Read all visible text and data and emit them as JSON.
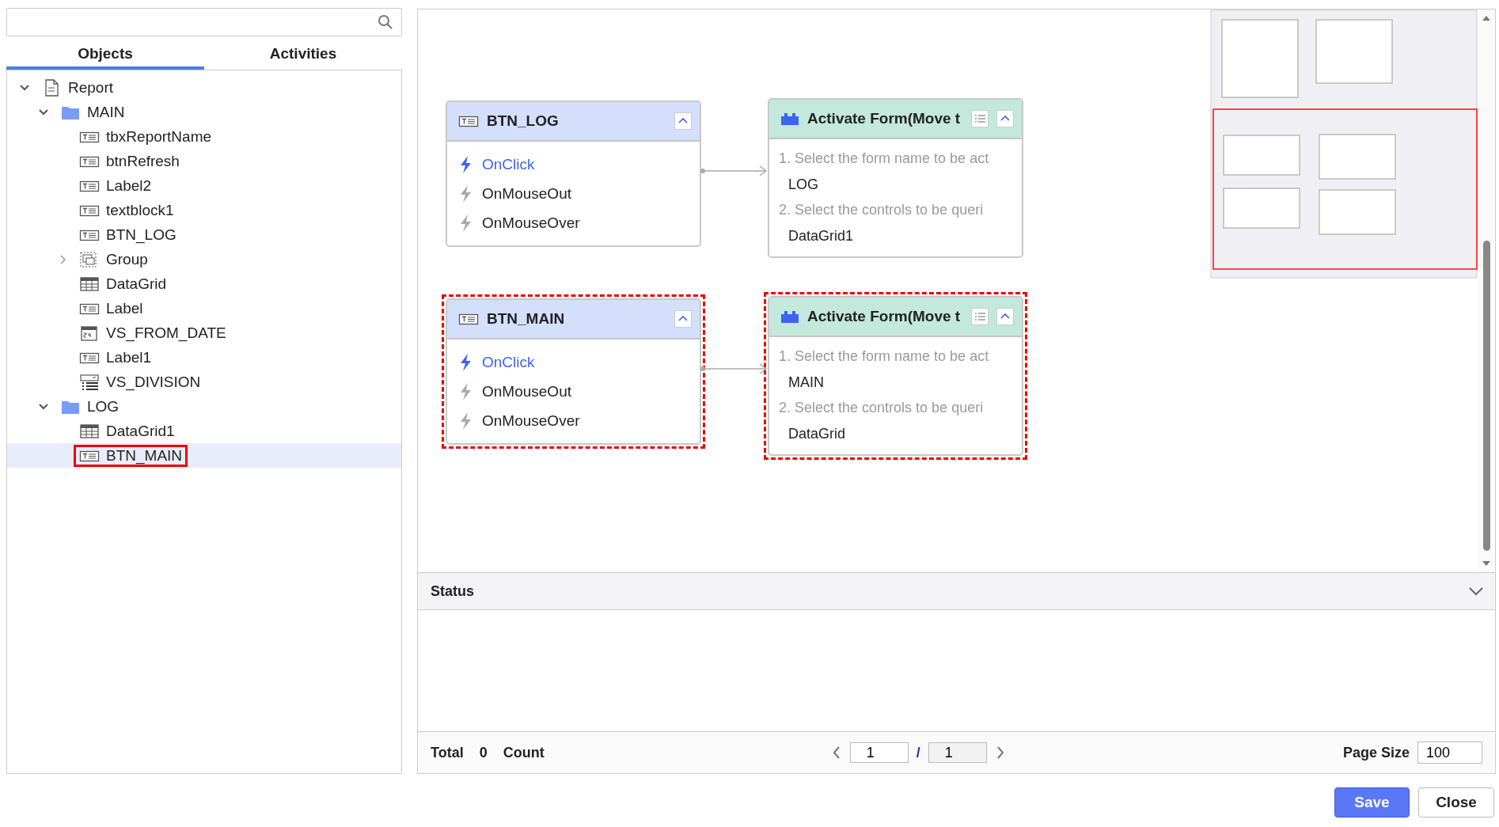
{
  "tabs": [
    {
      "label": "Objects",
      "selected": true
    },
    {
      "label": "Activities",
      "selected": false
    }
  ],
  "tree": [
    {
      "label": "Report",
      "kind": "report",
      "expanded": true,
      "selected": false,
      "marked": false,
      "children": [
        {
          "label": "MAIN",
          "kind": "folder",
          "expanded": true,
          "selected": false,
          "marked": false,
          "children": [
            {
              "label": "tbxReportName",
              "kind": "textbox",
              "selected": false,
              "marked": false
            },
            {
              "label": "btnRefresh",
              "kind": "textbox",
              "selected": false,
              "marked": false
            },
            {
              "label": "Label2",
              "kind": "textbox",
              "selected": false,
              "marked": false
            },
            {
              "label": "textblock1",
              "kind": "textbox",
              "selected": false,
              "marked": false
            },
            {
              "label": "BTN_LOG",
              "kind": "textbox",
              "selected": false,
              "marked": false
            },
            {
              "label": "Group",
              "kind": "group",
              "expanded": false,
              "selected": false,
              "marked": false
            },
            {
              "label": "DataGrid",
              "kind": "grid",
              "selected": false,
              "marked": false
            },
            {
              "label": "Label",
              "kind": "textbox",
              "selected": false,
              "marked": false
            },
            {
              "label": "VS_FROM_DATE",
              "kind": "date",
              "selected": false,
              "marked": false
            },
            {
              "label": "Label1",
              "kind": "textbox",
              "selected": false,
              "marked": false
            },
            {
              "label": "VS_DIVISION",
              "kind": "combo",
              "selected": false,
              "marked": false
            }
          ]
        },
        {
          "label": "LOG",
          "kind": "folder",
          "expanded": true,
          "selected": false,
          "marked": false,
          "children": [
            {
              "label": "DataGrid1",
              "kind": "grid",
              "selected": false,
              "marked": false
            },
            {
              "label": "BTN_MAIN",
              "kind": "textbox",
              "selected": true,
              "marked": true
            }
          ]
        }
      ]
    }
  ],
  "flows": [
    {
      "source": {
        "title": "BTN_LOG",
        "marked": false,
        "events": [
          {
            "label": "OnClick",
            "active": true
          },
          {
            "label": "OnMouseOut",
            "active": false
          },
          {
            "label": "OnMouseOver",
            "active": false
          }
        ]
      },
      "action": {
        "title": "Activate Form(Move t",
        "marked": false,
        "steps": [
          {
            "prompt": "1. Select the form name to be act",
            "value": "LOG"
          },
          {
            "prompt": "2. Select the controls to be queri",
            "value": "DataGrid1"
          }
        ]
      }
    },
    {
      "source": {
        "title": "BTN_MAIN",
        "marked": true,
        "events": [
          {
            "label": "OnClick",
            "active": true
          },
          {
            "label": "OnMouseOut",
            "active": false
          },
          {
            "label": "OnMouseOver",
            "active": false
          }
        ]
      },
      "action": {
        "title": "Activate Form(Move t",
        "marked": true,
        "steps": [
          {
            "prompt": "1. Select the form name to be act",
            "value": "MAIN"
          },
          {
            "prompt": "2. Select the controls to be queri",
            "value": "DataGrid"
          }
        ]
      }
    }
  ],
  "status": {
    "title": "Status"
  },
  "footer": {
    "total_label": "Total",
    "count": "0",
    "count_label": "Count",
    "page": "1",
    "separator": "/",
    "pages": "1",
    "page_size_label": "Page Size",
    "page_size": "100"
  },
  "buttons": [
    {
      "label": "Save",
      "kind": "primary"
    },
    {
      "label": "Close",
      "kind": "secondary"
    }
  ]
}
